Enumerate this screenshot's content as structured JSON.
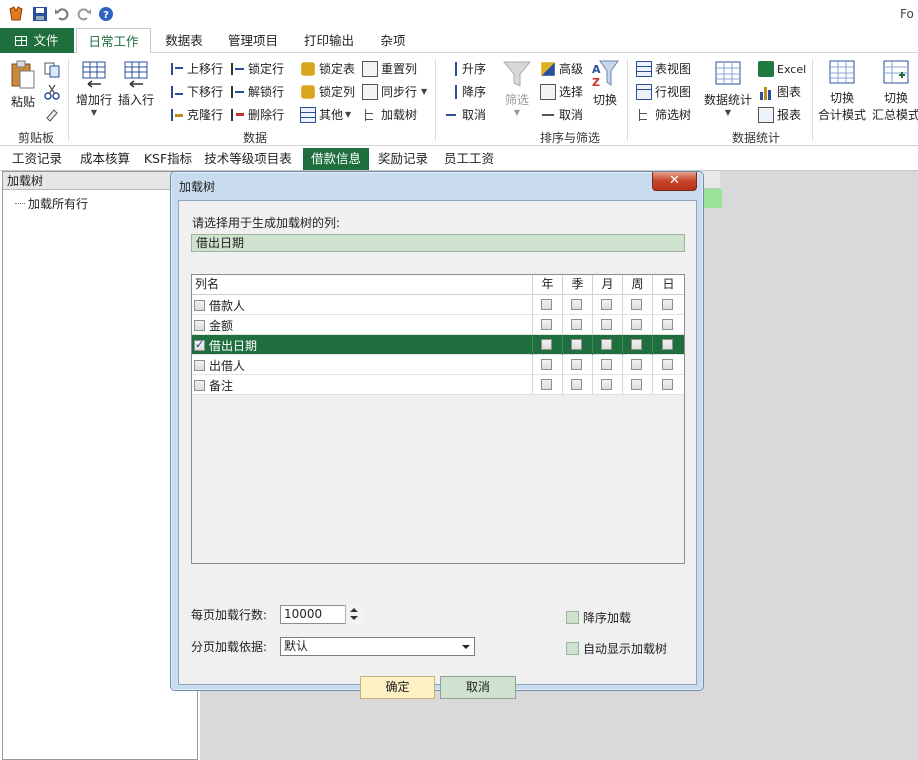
{
  "app": {
    "title_partial": "Fo"
  },
  "ribbon_tabs": {
    "file": "文件",
    "items": [
      "日常工作",
      "数据表",
      "管理项目",
      "打印输出",
      "杂项"
    ]
  },
  "ribbon": {
    "clipboard": {
      "paste": "粘贴",
      "group_label": "剪贴板"
    },
    "data": {
      "add_row": "增加行",
      "insert_row": "插入行",
      "move_up": "上移行",
      "move_down": "下移行",
      "clone_row": "克隆行",
      "lock_row": "锁定行",
      "unlock_row": "解锁行",
      "delete_row": "删除行",
      "lock_table": "锁定表",
      "lock_col": "锁定列",
      "other": "其他",
      "reset_col": "重置列",
      "sync_row": "同步行",
      "load_tree": "加载树",
      "group_label": "数据"
    },
    "sort": {
      "asc": "升序",
      "desc": "降序",
      "cancel": "取消",
      "filter": "筛选",
      "advanced": "高级",
      "select": "选择",
      "cancel2": "取消",
      "switch": "切换",
      "group_label": "排序与筛选"
    },
    "views": {
      "table_view": "表视图",
      "row_view": "行视图",
      "filter_tree": "筛选树",
      "excel": "Excel",
      "chart": "图表",
      "report": "报表",
      "data_stats": "数据统计",
      "switch_total_1": "切换",
      "switch_total_2": "合计模式",
      "switch_summary_1": "切换",
      "switch_summary_2": "汇总模式",
      "group_label": "数据统计"
    }
  },
  "sheet_tabs": [
    "工资记录",
    "成本核算",
    "KSF指标",
    "技术等级项目表",
    "借款信息",
    "奖励记录",
    "员工工资"
  ],
  "active_sheet_index": 4,
  "tree_panel": {
    "header": "加载树",
    "item": "加载所有行"
  },
  "dialog": {
    "title": "加载树",
    "close": "✕",
    "prompt": "请选择用于生成加载树的列:",
    "selected_columns": "借出日期",
    "table": {
      "headers": [
        "列名",
        "年",
        "季",
        "月",
        "周",
        "日"
      ],
      "rows": [
        {
          "name": "借款人",
          "checked": false
        },
        {
          "name": "金额",
          "checked": false
        },
        {
          "name": "借出日期",
          "checked": true
        },
        {
          "name": "出借人",
          "checked": false
        },
        {
          "name": "备注",
          "checked": false
        }
      ],
      "selected_row_index": 2
    },
    "rows_per_page_label": "每页加载行数:",
    "rows_per_page_value": "10000",
    "page_by_label": "分页加载依据:",
    "page_by_value": "默认",
    "desc_load": "降序加载",
    "auto_show_tree": "自动显示加载树",
    "ok": "确定",
    "cancel": "取消"
  },
  "colors": {
    "accent_green": "#1e6e3e",
    "title_bar_blue": "#c9dcef",
    "close_red": "#c8452b"
  }
}
